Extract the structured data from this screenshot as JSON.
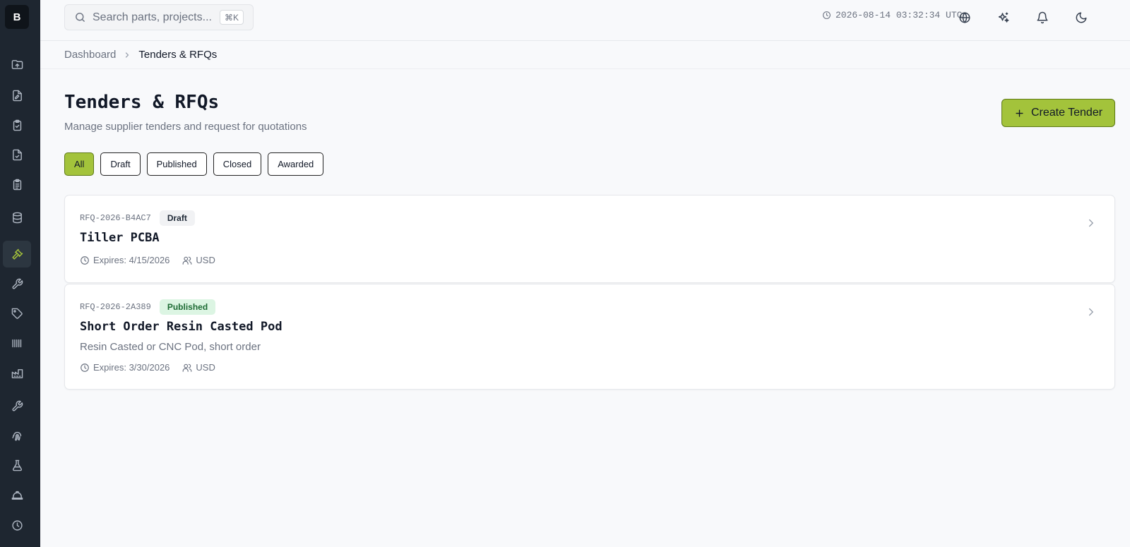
{
  "sidebar": {
    "logo": "B",
    "items": [
      {
        "icon": "folder-upload-icon"
      },
      {
        "icon": "file-edit-icon"
      },
      {
        "icon": "clipboard-check-icon"
      },
      {
        "icon": "file-check-icon"
      },
      {
        "icon": "clipboard-list-icon"
      },
      {
        "icon": "database-icon"
      },
      {
        "icon": "gavel-icon",
        "active": true
      },
      {
        "icon": "wrench-icon"
      },
      {
        "icon": "tag-icon"
      },
      {
        "icon": "barcode-icon"
      },
      {
        "icon": "factory-icon"
      },
      {
        "icon": "wrench-icon"
      },
      {
        "icon": "fingerprint-icon"
      },
      {
        "icon": "flask-icon"
      },
      {
        "icon": "hard-hat-icon"
      },
      {
        "icon": "clock-icon"
      }
    ],
    "accent_color": "#a6c43a"
  },
  "topbar": {
    "search_placeholder": "Search parts, projects...",
    "search_shortcut": "⌘K",
    "timestamp": "2026-08-14 03:32:34 UTC",
    "icons": [
      "globe-icon",
      "sparkles-icon",
      "bell-icon",
      "moon-icon"
    ]
  },
  "breadcrumb": {
    "root": "Dashboard",
    "current": "Tenders & RFQs"
  },
  "header": {
    "title": "Tenders & RFQs",
    "subtitle": "Manage supplier tenders and request for quotations",
    "create_label": "Create Tender"
  },
  "filters": [
    {
      "label": "All",
      "active": true
    },
    {
      "label": "Draft"
    },
    {
      "label": "Published"
    },
    {
      "label": "Closed"
    },
    {
      "label": "Awarded"
    }
  ],
  "tenders": [
    {
      "id": "RFQ-2026-B4AC7",
      "status": "Draft",
      "title": "Tiller PCBA",
      "description": "",
      "expires": "Expires: 4/15/2026",
      "currency": "USD"
    },
    {
      "id": "RFQ-2026-2A389",
      "status": "Published",
      "title": "Short Order Resin Casted Pod",
      "description": "Resin Casted or CNC Pod, short order",
      "expires": "Expires: 3/30/2026",
      "currency": "USD"
    }
  ],
  "colors": {
    "brand_green": "#a3c33b",
    "sidebar_bg": "#1e2630",
    "published_badge": "#dcf5e3"
  }
}
